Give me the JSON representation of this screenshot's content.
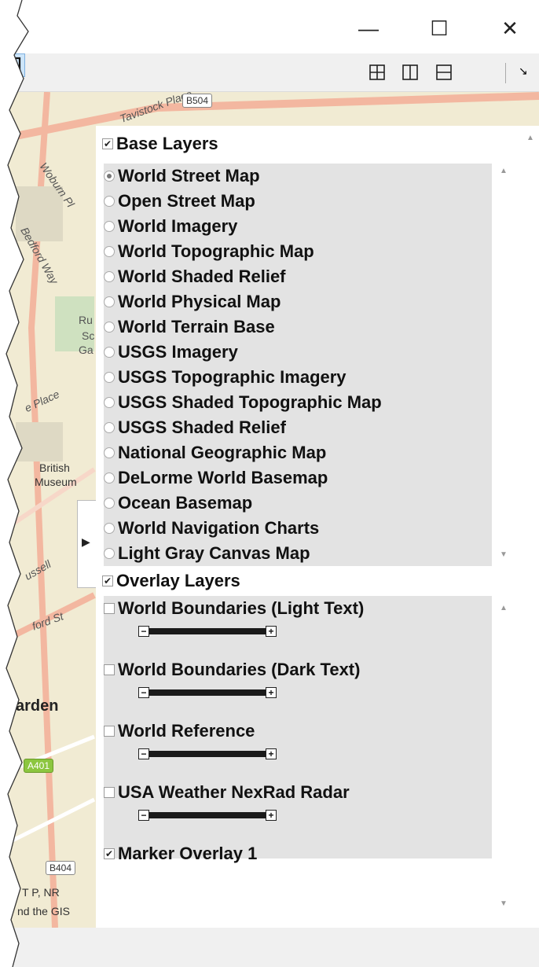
{
  "window": {
    "minimize_symbol": "—",
    "maximize_symbol": "☐",
    "close_symbol": "✕"
  },
  "toolbar": {
    "buttons": [
      "layout-grid-icon",
      "layout-columns-icon",
      "layout-rows-icon",
      "layout-single-icon"
    ],
    "undock_symbol": "↘"
  },
  "map": {
    "labels": [
      "Tavistock Place",
      "Woburn Pl",
      "Bedford Way",
      "e Place",
      "ussell",
      "ford St"
    ],
    "texts": [
      "British",
      "Museum",
      "Ru",
      "Sc",
      "Ga",
      "arden",
      "T P, NR",
      "nd the GIS"
    ],
    "shields": [
      "B504",
      "A401",
      "B404"
    ]
  },
  "panel": {
    "collapse_symbol": "▶",
    "base_layers": {
      "header": "Base Layers",
      "checked": true,
      "selected": "World Street Map",
      "items": [
        "World Street Map",
        "Open Street Map",
        "World Imagery",
        "World Topographic Map",
        "World Shaded Relief",
        "World Physical Map",
        "World Terrain Base",
        "USGS Imagery",
        "USGS Topographic Imagery",
        "USGS Shaded Topographic Map",
        "USGS Shaded Relief",
        "National Geographic Map",
        "DeLorme World Basemap",
        "Ocean Basemap",
        "World Navigation Charts",
        "Light Gray Canvas Map"
      ]
    },
    "overlay_layers": {
      "header": "Overlay Layers",
      "checked": true,
      "items": [
        {
          "label": "World Boundaries (Light Text)",
          "checked": false,
          "has_slider": true
        },
        {
          "label": "World Boundaries (Dark Text)",
          "checked": false,
          "has_slider": true
        },
        {
          "label": "World Reference",
          "checked": false,
          "has_slider": true
        },
        {
          "label": "USA Weather NexRad Radar",
          "checked": false,
          "has_slider": true
        },
        {
          "label": "Marker Overlay 1",
          "checked": true,
          "has_slider": false
        }
      ],
      "slider_minus": "−",
      "slider_plus": "+"
    },
    "colors": {
      "list_bg": "#e3e3e3",
      "map_bg": "#f1ebd3",
      "road": "#f3b7a0"
    }
  }
}
